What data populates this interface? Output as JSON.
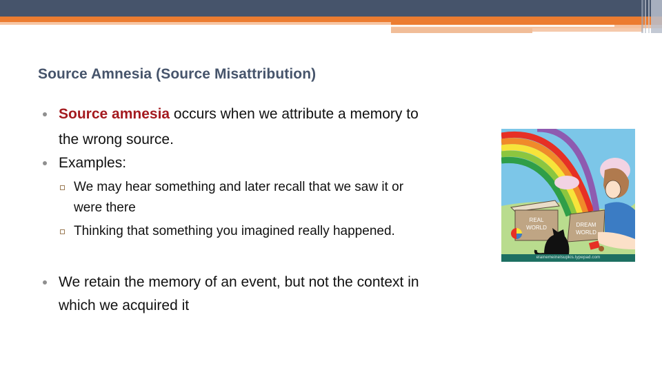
{
  "slide": {
    "title": "Source Amnesia (Source Misattribution)",
    "bullets": [
      {
        "highlight": "Source amnesia",
        "line1_rest": " occurs when we attribute a memory to",
        "line2": "the wrong source."
      },
      {
        "text": "Examples:",
        "sub_bullets": [
          {
            "line1": "We may hear something and later recall that we saw it or",
            "line2": "were there"
          },
          {
            "line1": "Thinking that something you imagined really happened."
          }
        ]
      },
      {
        "line1": "We retain the memory of an event, but not the context in",
        "line2": "which we acquired it"
      }
    ],
    "illustration": {
      "description": "cartoon of a girl between a REAL WORLD box and a DREAM WORLD box with a rainbow",
      "box_left_label_1": "REAL",
      "box_left_label_2": "WORLD",
      "box_right_label_1": "DREAM",
      "box_right_label_2": "WORLD",
      "caption": "elainemeinelsupkis.typepad.com"
    }
  },
  "colors": {
    "header_dark": "#46546b",
    "header_accent": "#ec7c30",
    "title": "#46546b",
    "highlight": "#a41a1f",
    "bullet_dot": "#8f8f8f",
    "sub_bullet_border": "#9b7b55"
  }
}
